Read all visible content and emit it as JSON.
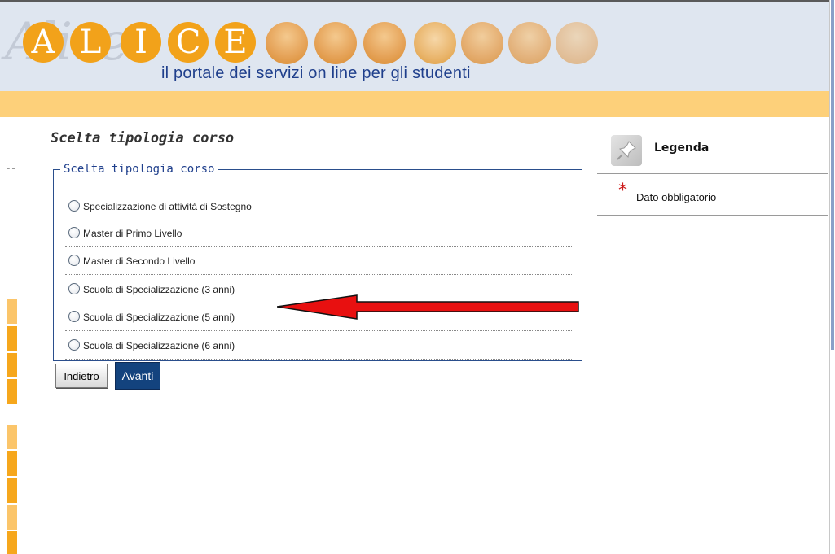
{
  "header": {
    "watermark": "Alice",
    "letters": [
      "A",
      "L",
      "I",
      "C",
      "E"
    ],
    "tagline": "il portale dei servizi on line per gli studenti"
  },
  "page": {
    "title": "Scelta tipologia corso"
  },
  "form": {
    "fieldset_legend": "Scelta tipologia corso",
    "options": [
      {
        "label": "Specializzazione di attività di Sostegno",
        "selected": false
      },
      {
        "label": "Master di Primo Livello",
        "selected": false
      },
      {
        "label": "Master di Secondo Livello",
        "selected": false
      },
      {
        "label": "Scuola di Specializzazione (3 anni)",
        "selected": false
      },
      {
        "label": "Scuola di Specializzazione (5 anni)",
        "selected": false
      },
      {
        "label": "Scuola di Specializzazione (6 anni)",
        "selected": false
      }
    ],
    "back_label": "Indietro",
    "next_label": "Avanti"
  },
  "legend_panel": {
    "title": "Legenda",
    "required_symbol": "*",
    "required_label": "Dato obbligatorio",
    "icon": "pin-icon"
  },
  "colors": {
    "header_bg": "#dfe6f0",
    "brand_orange": "#f2a21a",
    "orange_bar": "#fdd07a",
    "tagline_blue": "#1f3f8c",
    "primary_button": "#13437e",
    "arrow_red": "#e81010",
    "required_red": "#cc1a1a"
  },
  "annotation": {
    "type": "arrow",
    "points_to": "Scuola di Specializzazione (5 anni)"
  }
}
